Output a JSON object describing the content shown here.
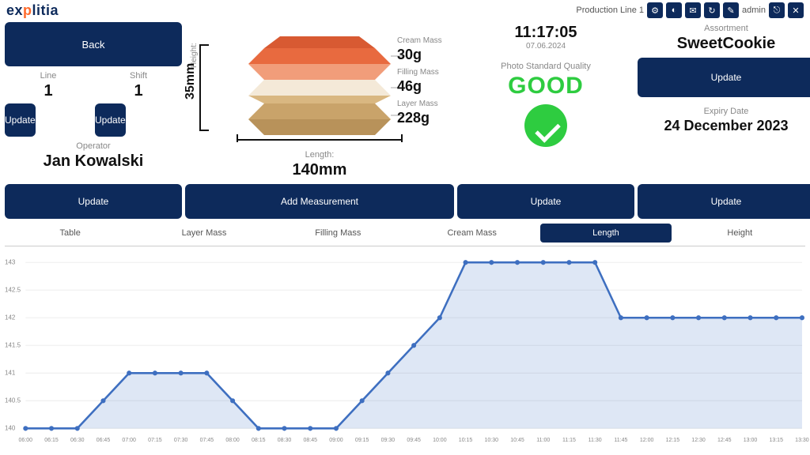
{
  "brand": {
    "pre": "ex",
    "accent": "p",
    "post": "litia"
  },
  "topbar": {
    "context": "Production Line 1",
    "user_label": "admin",
    "icons": [
      "gear",
      "moon",
      "mail",
      "refresh",
      "edit",
      "logout",
      "close"
    ]
  },
  "col1": {
    "back": "Back",
    "line_label": "Line",
    "line_value": "1",
    "shift_label": "Shift",
    "shift_value": "1",
    "update": "Update",
    "operator_label": "Operator",
    "operator_value": "Jan Kowalski"
  },
  "product": {
    "height_label": "Height:",
    "height_value": "35mm",
    "length_label": "Length:",
    "length_value": "140mm",
    "layers": [
      {
        "name": "Cream Mass",
        "value": "30g"
      },
      {
        "name": "Filling Mass",
        "value": "46g"
      },
      {
        "name": "Layer Mass",
        "value": "228g"
      }
    ]
  },
  "status": {
    "time": "11:17:05",
    "date": "07.06.2024",
    "quality_label": "Photo Standard Quality",
    "quality_value": "GOOD"
  },
  "assort": {
    "label": "Assortment",
    "value": "SweetCookie",
    "update": "Update",
    "expiry_label": "Expiry Date",
    "expiry_value": "24 December 2023"
  },
  "row_buttons": {
    "b1": "Update",
    "b2": "Add Measurement",
    "b3": "Update",
    "b4": "Update"
  },
  "tabs": [
    "Table",
    "Layer Mass",
    "Filling Mass",
    "Cream Mass",
    "Length",
    "Height"
  ],
  "active_tab": 4,
  "chart_data": {
    "type": "line",
    "ylabel": "",
    "ylim": [
      140,
      143.2
    ],
    "yticks": [
      140,
      140.5,
      141,
      141.5,
      142,
      142.5,
      143
    ],
    "categories": [
      "06:00",
      "06:15",
      "06:30",
      "06:45",
      "07:00",
      "07:15",
      "07:30",
      "07:45",
      "08:00",
      "08:15",
      "08:30",
      "08:45",
      "09:00",
      "09:15",
      "09:30",
      "09:45",
      "10:00",
      "10:15",
      "10:30",
      "10:45",
      "11:00",
      "11:15",
      "11:30",
      "11:45",
      "12:00",
      "12:15",
      "12:30",
      "12:45",
      "13:00",
      "13:15",
      "13:30"
    ],
    "values": [
      140,
      140,
      140,
      140.5,
      141,
      141,
      141,
      141,
      140.5,
      140,
      140,
      140,
      140,
      140.5,
      141,
      141.5,
      142,
      143,
      143,
      143,
      143,
      143,
      143,
      142,
      142,
      142,
      142,
      142,
      142,
      142,
      142
    ]
  }
}
